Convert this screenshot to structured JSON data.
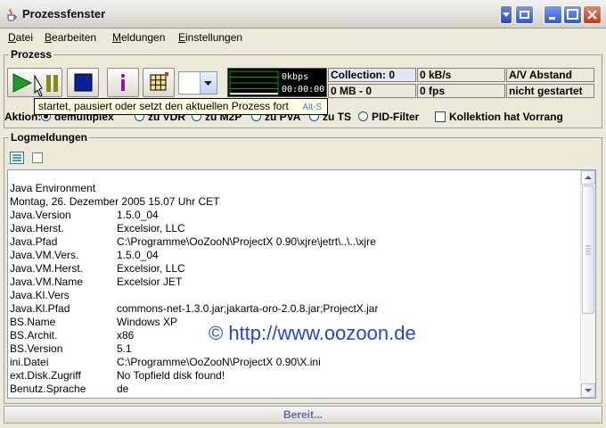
{
  "window": {
    "title": "Prozessfenster"
  },
  "menu": [
    {
      "label": "Datei",
      "mnemonic": "D",
      "rest": "atei"
    },
    {
      "label": "Bearbeiten",
      "mnemonic": "B",
      "rest": "earbeiten"
    },
    {
      "label": "Meldungen",
      "mnemonic": "M",
      "rest": "eldungen"
    },
    {
      "label": "Einstellungen",
      "mnemonic": "E",
      "rest": "instellungen"
    }
  ],
  "process_group": {
    "title": "Prozess"
  },
  "meter": {
    "rate": "0kbps",
    "time": "00:00:00"
  },
  "stats": {
    "collection": "Collection: 0",
    "rate": "0 kB/s",
    "av_label": "A/V Abstand",
    "mb": "0 MB - 0",
    "fps": "0 fps",
    "state": "nicht gestartet"
  },
  "tooltip": {
    "text": "startet, pausiert oder setzt den aktuellen Prozess fort",
    "accelerator": "Alt-S"
  },
  "action": {
    "label": "Aktion:",
    "options": [
      "demultiplex",
      "zu VDR",
      "zu M2P",
      "zu PVA",
      "zu TS",
      "PID-Filter"
    ],
    "selected": "demultiplex",
    "checkbox_label": "Kollektion hat Vorrang",
    "checkbox_checked": false
  },
  "log_group": {
    "title": "Logmeldungen"
  },
  "log": {
    "header": [
      "Java Environment",
      "Montag, 26. Dezember 2005     15.07 Uhr CET"
    ],
    "rows": [
      {
        "key": "Java.Version",
        "value": "1.5.0_04"
      },
      {
        "key": "Java.Herst.",
        "value": "Excelsior, LLC"
      },
      {
        "key": "Java.Pfad",
        "value": "C:\\Programme\\OoZooN\\ProjectX 0.90\\xjre\\jetrt\\..\\..\\xjre"
      },
      {
        "key": "Java.VM.Vers.",
        "value": "1.5.0_04"
      },
      {
        "key": "Java.VM.Herst.",
        "value": "Excelsior, LLC"
      },
      {
        "key": "Java.VM.Name",
        "value": "Excelsior JET"
      },
      {
        "key": "Java.Kl.Vers",
        "value": ""
      },
      {
        "key": "Java.Kl.Pfad",
        "value": "commons-net-1.3.0.jar;jakarta-oro-2.0.8.jar;ProjectX.jar"
      },
      {
        "key": "BS.Name",
        "value": "Windows XP"
      },
      {
        "key": "BS.Archit.",
        "value": "x86"
      },
      {
        "key": "BS.Version",
        "value": "5.1"
      },
      {
        "key": "ini.Datei",
        "value": "C:\\Programme\\OoZooN\\ProjectX 0.90\\X.ini"
      },
      {
        "key": "ext.Disk.Zugriff",
        "value": "No Topfield disk found!"
      },
      {
        "key": "Benutz.Sprache",
        "value": "de"
      }
    ]
  },
  "watermark": "© http://www.oozoon.de",
  "status": "Bereit...",
  "colors": {
    "accent_blue": "#2346d4",
    "meter_bg": "#000000",
    "meter_grid": "#0aa000",
    "play_green": "#1f9b2a",
    "stop_blue": "#0a1f9a",
    "info_purple": "#8a1f9a"
  }
}
